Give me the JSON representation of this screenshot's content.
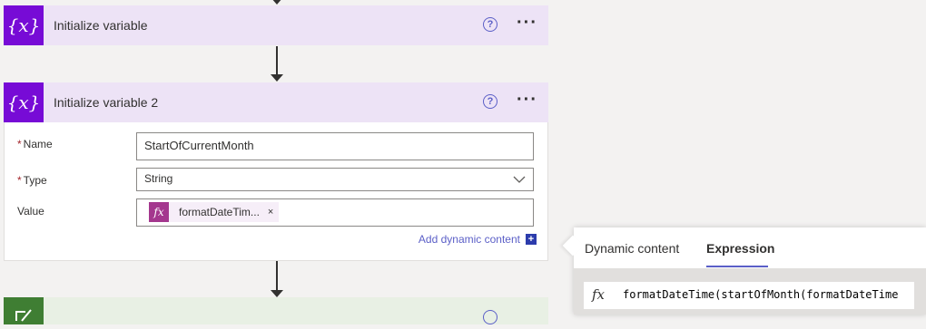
{
  "flow": {
    "step1": {
      "icon": "variable-icon",
      "icon_glyph": "{x}",
      "title": "Initialize variable",
      "help": "?",
      "more": "···"
    },
    "step2": {
      "icon": "variable-icon",
      "icon_glyph": "{x}",
      "title": "Initialize variable 2",
      "help": "?",
      "more": "···",
      "fields": {
        "name_label": "Name",
        "name_value": "StartOfCurrentMonth",
        "type_label": "Type",
        "type_value": "String",
        "value_label": "Value",
        "token_text": "formatDateTim...",
        "token_remove": "×",
        "required_mark": "*"
      },
      "add_dynamic": "Add dynamic content",
      "add_plus": "+"
    },
    "step3": {
      "icon": "compose-icon"
    }
  },
  "panel": {
    "tabs": [
      "Dynamic content",
      "Expression"
    ],
    "active_tab": "Expression",
    "fx_glyph": "fx",
    "expression": "formatDateTime(startOfMonth(formatDateTime"
  },
  "colors": {
    "accent": "#5b5fc7",
    "variable": "#770bd6",
    "token": "#a4378e",
    "compose": "#3f7e33"
  }
}
